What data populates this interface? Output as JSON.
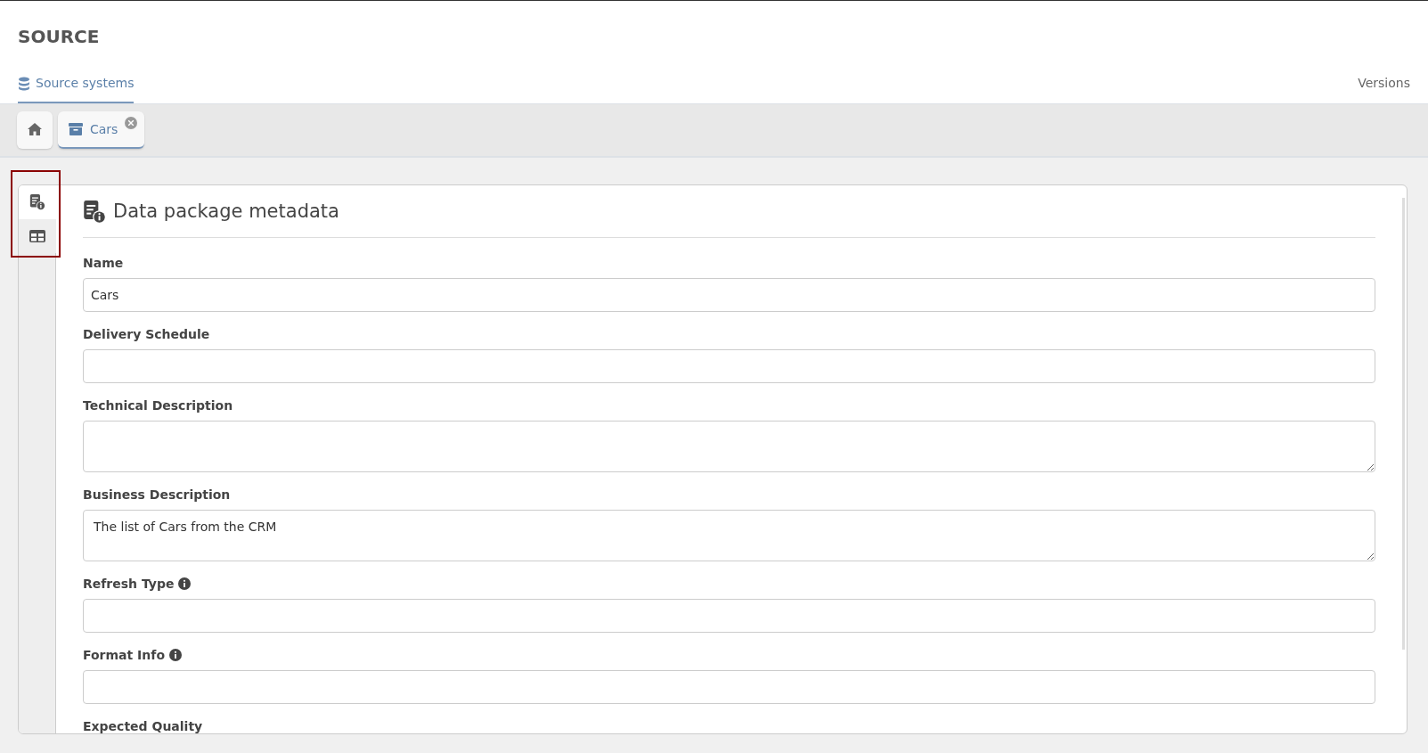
{
  "page_title": "SOURCE",
  "nav": [
    {
      "label": "Source systems",
      "selected": true
    },
    {
      "label": "Versions",
      "selected": false
    }
  ],
  "tabs": [
    {
      "kind": "home",
      "selected": false
    },
    {
      "kind": "item",
      "label": "Cars",
      "closable": true,
      "selected": true
    }
  ],
  "side_tabs": [
    {
      "kind": "details",
      "selected": true
    },
    {
      "kind": "table",
      "selected": false
    }
  ],
  "panel": {
    "title": "Data package metadata",
    "fields": [
      {
        "label": "Name",
        "kind": "input",
        "value": "Cars",
        "info": false
      },
      {
        "label": "Delivery Schedule",
        "kind": "input",
        "info": false
      },
      {
        "label": "Technical Description",
        "kind": "textarea",
        "info": false
      },
      {
        "label": "Business Description",
        "kind": "textarea",
        "value": "The list of Cars from the CRM",
        "info": false
      },
      {
        "label": "Refresh Type",
        "kind": "input",
        "info": true
      },
      {
        "label": "Format Info",
        "kind": "input",
        "info": true
      },
      {
        "label": "Expected Quality",
        "info": false
      }
    ]
  }
}
